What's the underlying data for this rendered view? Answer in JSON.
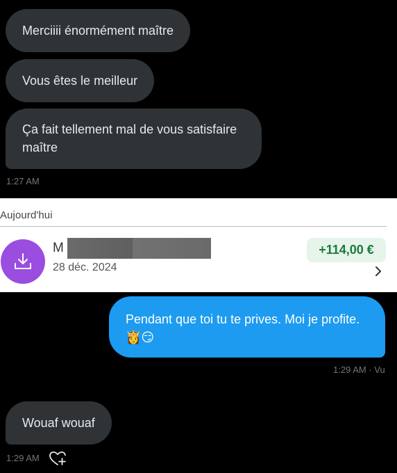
{
  "conversation": {
    "incoming_top": [
      {
        "text": "Merciiii énormément maître"
      },
      {
        "text": "Vous êtes le meilleur"
      },
      {
        "text": "Ça fait tellement mal de vous satisfaire maître"
      }
    ],
    "incoming_top_time": "1:27 AM",
    "outgoing": {
      "text": "Pendant que toi tu te prives. Moi je profite.",
      "emojis": "👸😏",
      "status": "1:29 AM · Vu"
    },
    "incoming_bottom": {
      "text": "Wouaf wouaf",
      "time": "1:29 AM"
    }
  },
  "bank_card": {
    "section_header": "Aujourd'hui",
    "merchant_initial": "M",
    "transaction_date": "28 déc. 2024",
    "amount": "+114,00 €",
    "icon": "download-icon",
    "accent_color": "#9b4de0",
    "amount_color": "#1e7a3c"
  },
  "icons": {
    "react": "heart-add-icon",
    "details": "chevron-right-icon"
  }
}
